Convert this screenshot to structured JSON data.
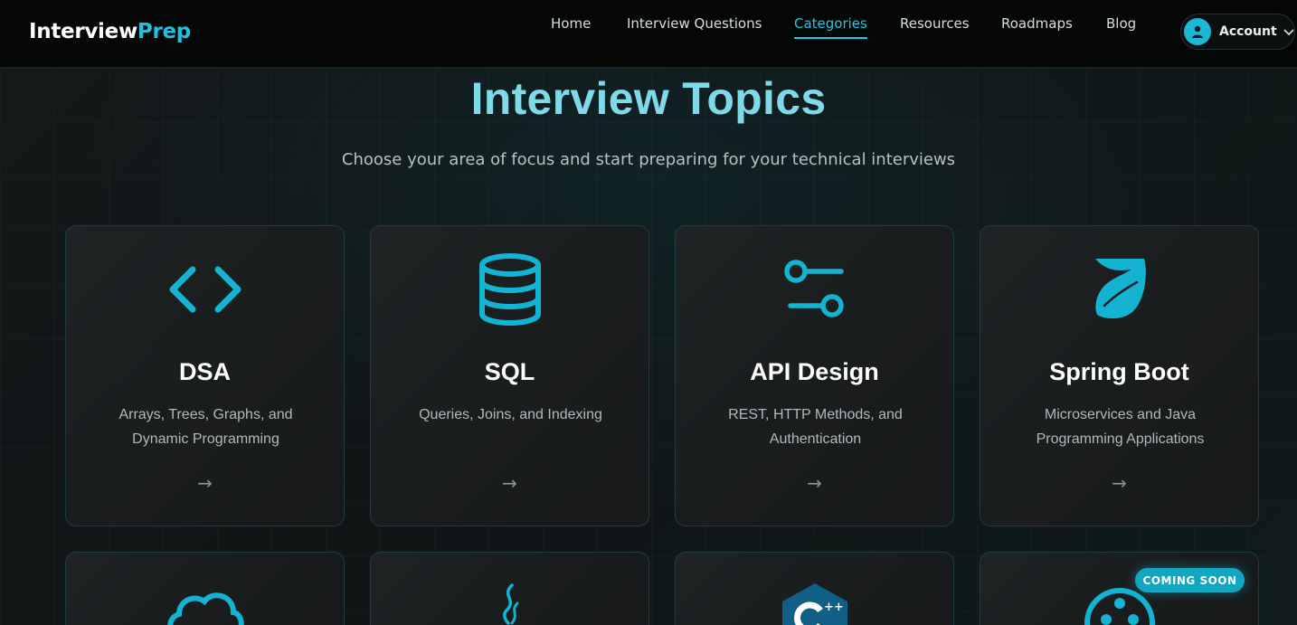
{
  "brand": {
    "part1": "Interview",
    "part2": "Prep"
  },
  "nav": {
    "items": [
      {
        "label": "Home",
        "active": false
      },
      {
        "label": "Interview Questions",
        "active": false
      },
      {
        "label": "Categories",
        "active": true
      },
      {
        "label": "Resources",
        "active": false
      },
      {
        "label": "Roadmaps",
        "active": false
      },
      {
        "label": "Blog",
        "active": false
      }
    ],
    "account_label": "Account"
  },
  "hero": {
    "title": "Interview Topics",
    "subtitle": "Choose your area of focus and start preparing for your technical interviews"
  },
  "cards": [
    {
      "icon": "code-icon",
      "title": "DSA",
      "description": "Arrays, Trees, Graphs, and Dynamic Programming",
      "arrow": "→"
    },
    {
      "icon": "database-icon",
      "title": "SQL",
      "description": "Queries, Joins, and Indexing",
      "arrow": "→"
    },
    {
      "icon": "api-sliders-icon",
      "title": "API Design",
      "description": "REST, HTTP Methods, and Authentication",
      "arrow": "→"
    },
    {
      "icon": "spring-leaf-icon",
      "title": "Spring Boot",
      "description": "Microservices and Java Programming Applications",
      "arrow": "→"
    }
  ],
  "cards_row2": [
    {
      "icon": "cloud-icon"
    },
    {
      "icon": "java-icon"
    },
    {
      "icon": "cpp-icon"
    },
    {
      "icon": "ml-icon",
      "badge": "COMING SOON"
    }
  ],
  "colors": {
    "accent": "#1fc3e0",
    "title_gradient": "#7fd9e8",
    "badge": "#12a6c1"
  }
}
